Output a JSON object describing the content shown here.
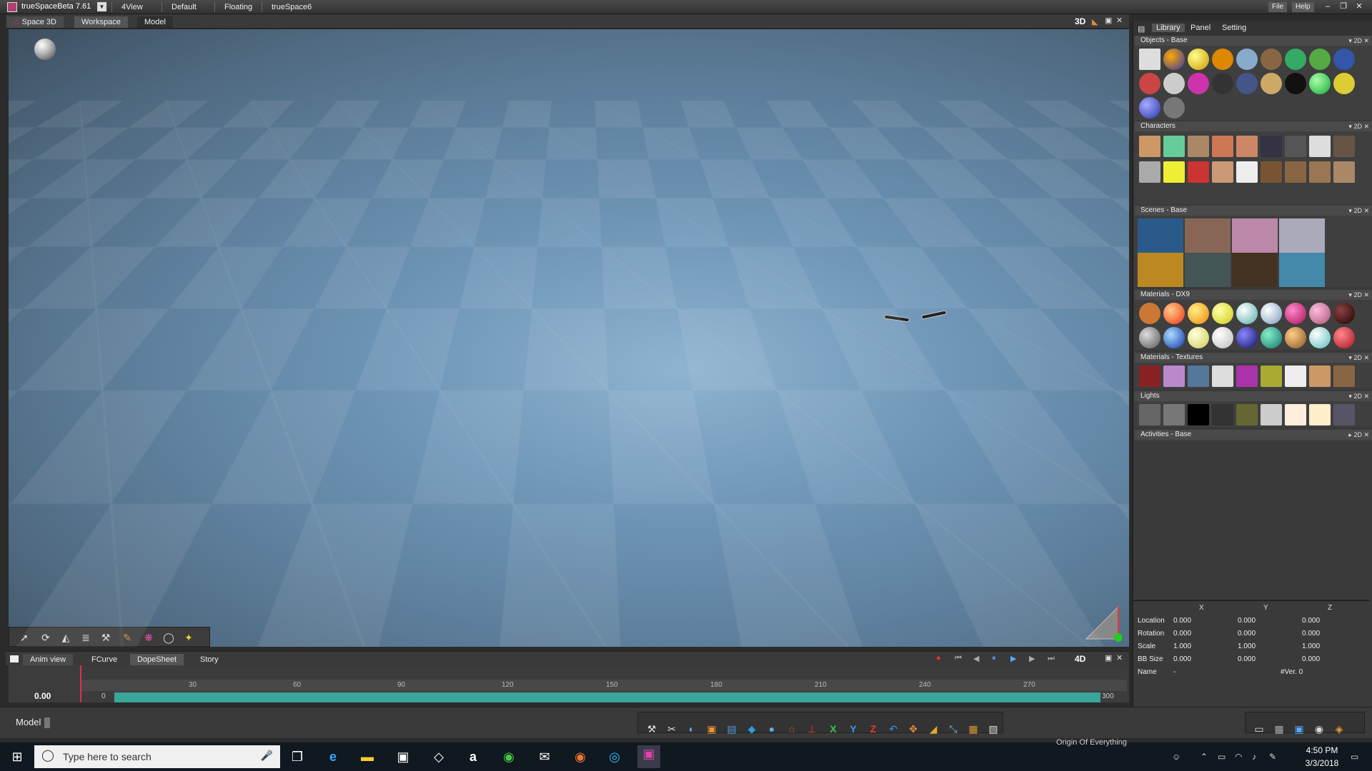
{
  "titlebar": {
    "title": "trueSpaceBeta 7.61",
    "menus": [
      "4View",
      "Default",
      "Floating",
      "trueSpace6"
    ],
    "right_buttons": [
      "File",
      "Help"
    ]
  },
  "viewport": {
    "tabs": [
      "Space 3D",
      "Workspace",
      "Model"
    ],
    "mode_label": "3D"
  },
  "library": {
    "tabs": [
      "Library",
      "Panel",
      "Setting"
    ],
    "sections": [
      {
        "title": "Objects - Base"
      },
      {
        "title": "Characters"
      },
      {
        "title": "Scenes - Base"
      },
      {
        "title": "Materials - DX9"
      },
      {
        "title": "Materials - Textures"
      },
      {
        "title": "Lights"
      },
      {
        "title": "Activities - Base"
      }
    ],
    "section_ctrl": "2D"
  },
  "properties": {
    "columns": [
      "X",
      "Y",
      "Z"
    ],
    "rows": [
      {
        "label": "Location",
        "x": "0.000",
        "y": "0.000",
        "z": "0.000"
      },
      {
        "label": "Rotation",
        "x": "0.000",
        "y": "0.000",
        "z": "0.000"
      },
      {
        "label": "Scale",
        "x": "1.000",
        "y": "1.000",
        "z": "1.000"
      },
      {
        "label": "BB Size",
        "x": "0.000",
        "y": "0.000",
        "z": "0.000"
      }
    ],
    "name_label": "Name",
    "name_value": "-",
    "version": "#Ver. 0"
  },
  "anim": {
    "title": "Anim view",
    "tabs": [
      "FCurve",
      "DopeSheet",
      "Story"
    ],
    "mode_label": "4D",
    "time_value": "0.00",
    "ruler_ticks": [
      "30",
      "60",
      "90",
      "120",
      "150",
      "180",
      "210",
      "240",
      "270"
    ],
    "start": "0",
    "end": "300"
  },
  "status": {
    "label": "Model"
  },
  "taskbar": {
    "search_placeholder": "Type here to search",
    "time": "4:50 PM",
    "date": "3/3/2018",
    "background_window": "Origin Of Everything"
  }
}
